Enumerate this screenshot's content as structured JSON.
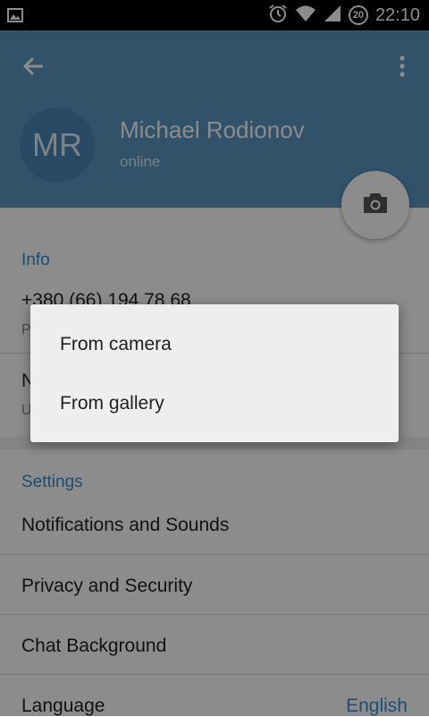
{
  "status_bar": {
    "time": "22:10",
    "battery": "20",
    "icons": [
      "gallery-icon",
      "alarm-icon",
      "wifi-icon",
      "signal-icon",
      "battery-icon"
    ]
  },
  "profile": {
    "initials": "MR",
    "name": "Michael Rodionov",
    "status": "online",
    "header_color": "#5b95c2"
  },
  "info": {
    "title": "Info",
    "phone": "+380 (66) 194 78 68",
    "phone_sub": "P",
    "username_label": "N",
    "username_sub": "U"
  },
  "settings": {
    "title": "Settings",
    "items": [
      {
        "label": "Notifications and Sounds"
      },
      {
        "label": "Privacy and Security"
      },
      {
        "label": "Chat Background"
      },
      {
        "label": "Language",
        "value": "English"
      }
    ]
  },
  "dialog": {
    "options": [
      {
        "label": "From camera"
      },
      {
        "label": "From gallery"
      }
    ]
  },
  "colors": {
    "accent": "#3a8ad0",
    "dialog_bg": "#eeeeee"
  }
}
